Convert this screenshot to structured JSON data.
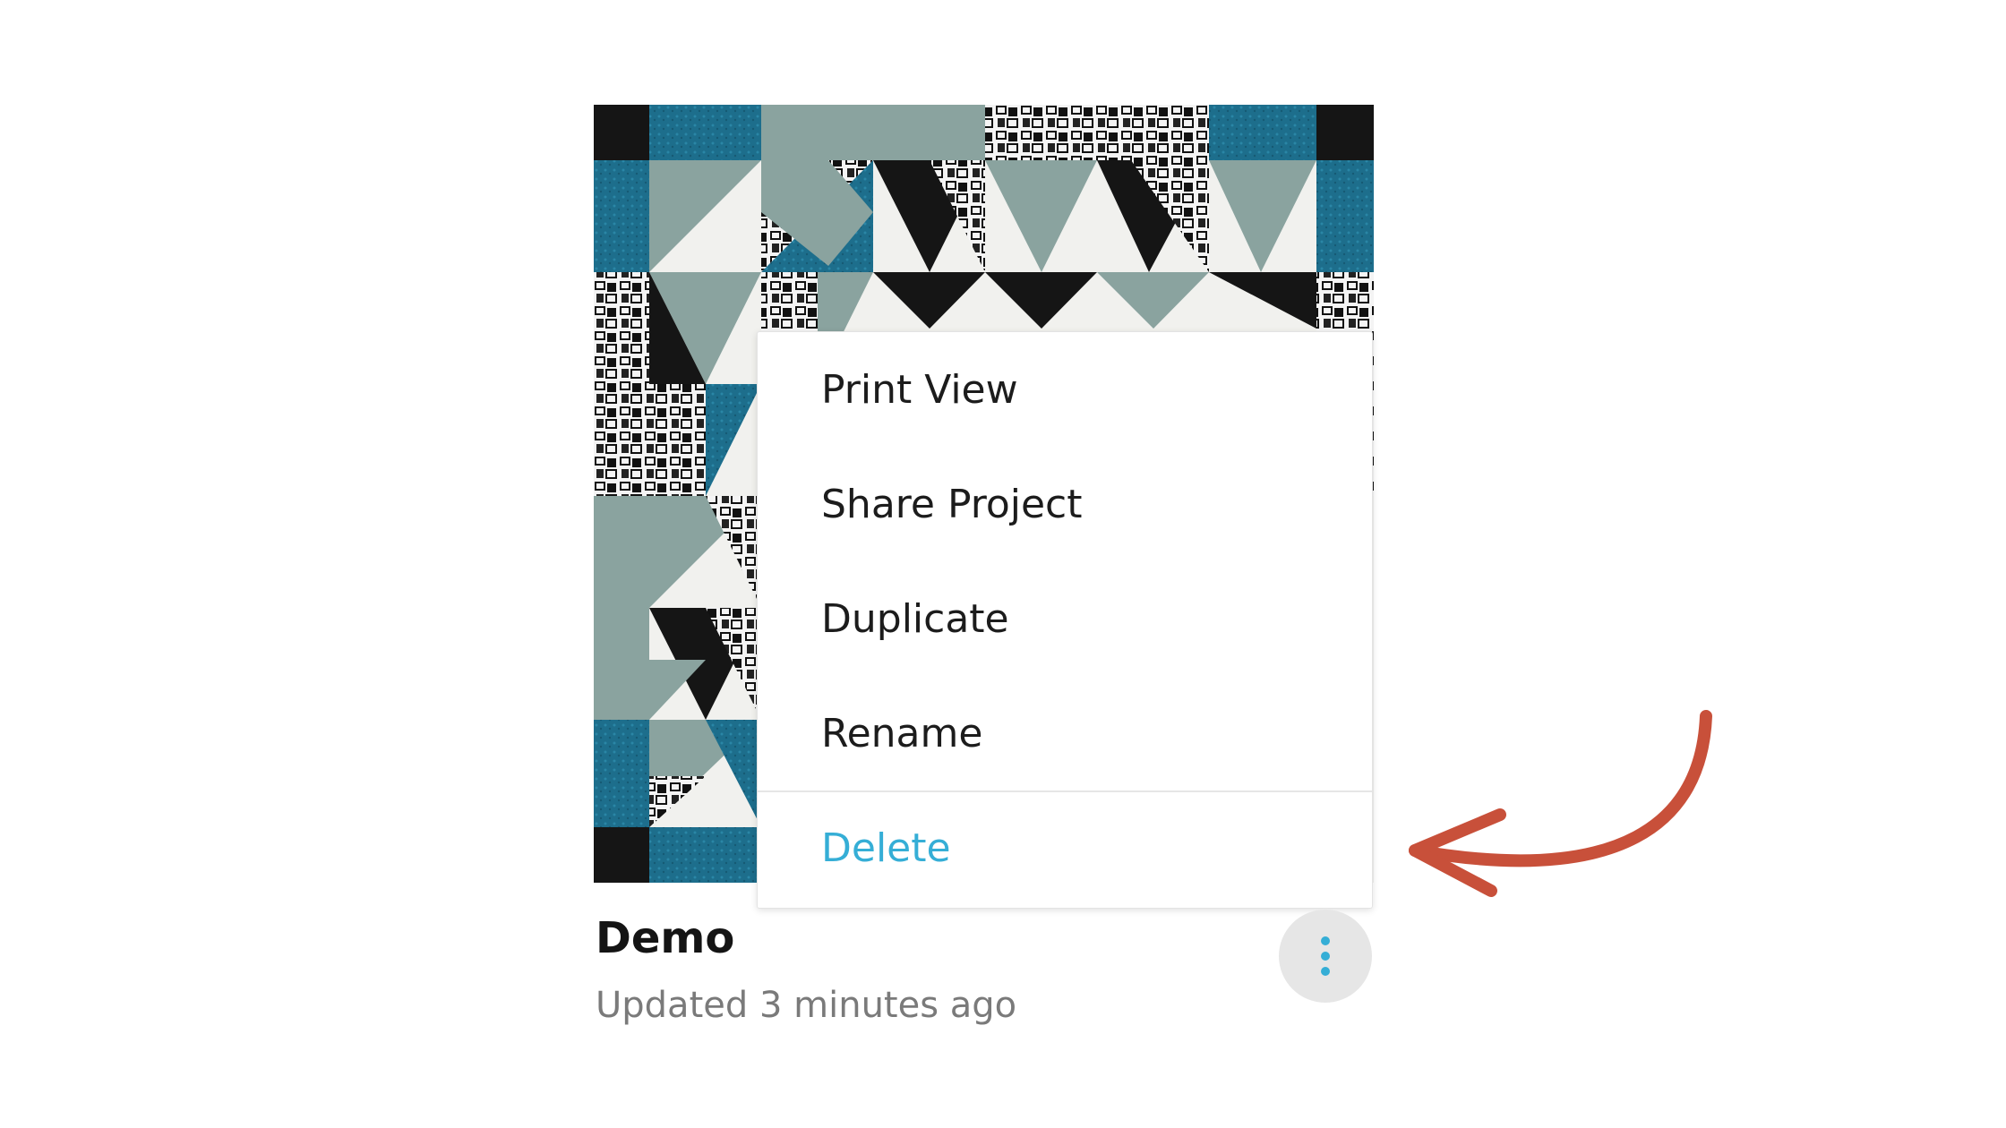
{
  "colors": {
    "accent": "#35aed6",
    "teal": "#1b6f8f",
    "sage": "#8aa39f",
    "arrow": "#c8503a",
    "kebab_bg": "#e6e6e6"
  },
  "project": {
    "name": "Demo",
    "updated": "Updated 3 minutes ago"
  },
  "menu": {
    "items": [
      {
        "label": "Print View"
      },
      {
        "label": "Share Project"
      },
      {
        "label": "Duplicate"
      },
      {
        "label": "Rename"
      }
    ],
    "danger": {
      "label": "Delete"
    }
  },
  "icons": {
    "more": "more-vertical-icon",
    "annotation": "curved-arrow-icon"
  }
}
